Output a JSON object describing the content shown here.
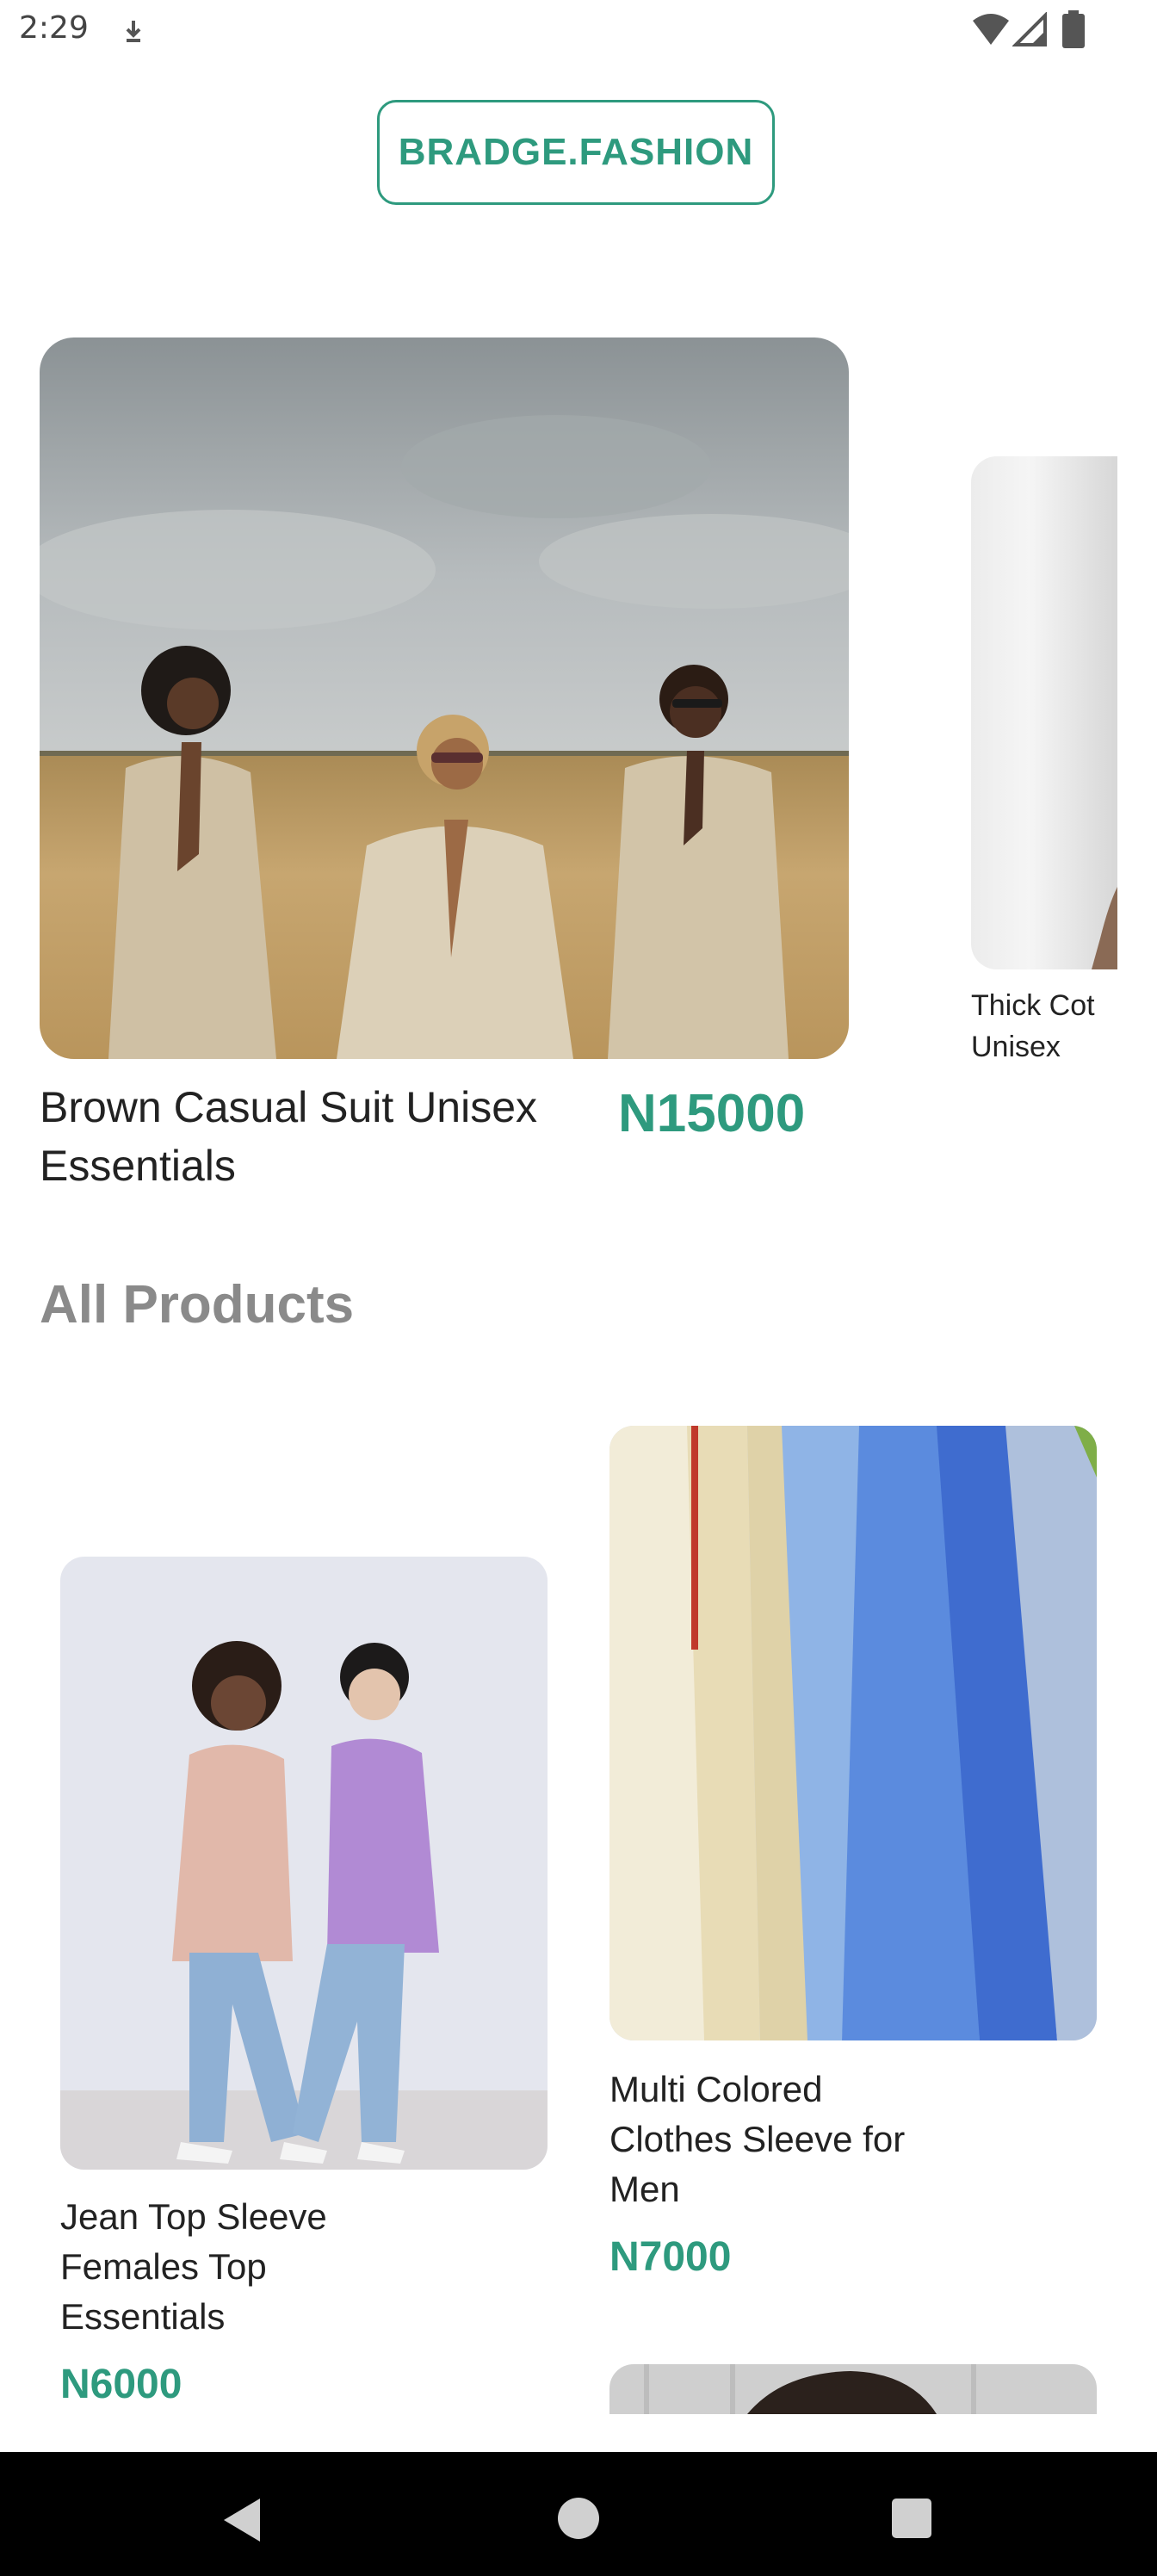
{
  "status_bar": {
    "time": "2:29",
    "icons": [
      "download-icon",
      "wifi-icon",
      "cellular-signal-icon",
      "battery-icon"
    ]
  },
  "header": {
    "logo_text": "BRADGE.FASHION"
  },
  "featured": {
    "items": [
      {
        "name": "Brown Casual Suit Unisex Essentials",
        "price": "N15000"
      },
      {
        "name": "Thick Cot Unisex",
        "name_line1": "Thick Cot",
        "name_line2": "Unisex"
      }
    ]
  },
  "all_products": {
    "title": "All Products",
    "items": [
      {
        "name_lines": [
          "Jean Top Sleeve",
          "Females Top",
          "Essentials"
        ],
        "price": "N6000"
      },
      {
        "name_lines": [
          "Multi Colored",
          "Clothes Sleeve for",
          "Men"
        ],
        "price": "N7000"
      }
    ]
  },
  "nav_bar": {
    "icons": [
      "back-icon",
      "home-icon",
      "recents-icon"
    ]
  },
  "colors": {
    "accent": "#2e9a7e",
    "section_title": "#8a8a8a",
    "nav_bg": "#000000"
  }
}
